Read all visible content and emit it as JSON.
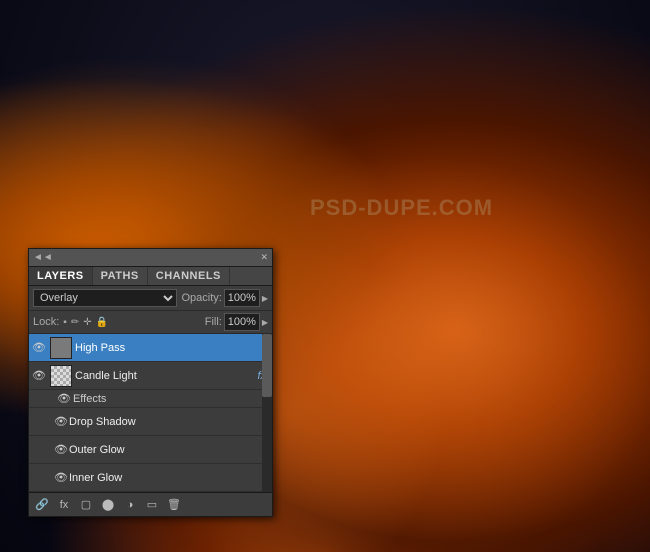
{
  "bg": {
    "alt": "Halloween pumpkin with fire and dark forest background"
  },
  "panel": {
    "title_arrows": "◄◄",
    "close_btn": "✕",
    "tabs": [
      {
        "label": "LAYERS",
        "active": true
      },
      {
        "label": "PATHS",
        "active": false
      },
      {
        "label": "CHANNELS",
        "active": false
      }
    ],
    "blend_mode": {
      "label": "",
      "value": "Overlay",
      "opacity_label": "Opacity:",
      "opacity_value": "100%"
    },
    "lock_row": {
      "label": "Lock:",
      "fill_label": "Fill:",
      "fill_value": "100%"
    },
    "layers": [
      {
        "id": "high-pass",
        "name": "High Pass",
        "visible": true,
        "selected": true,
        "thumb_type": "gray-solid",
        "has_fx": false
      },
      {
        "id": "candle-light",
        "name": "Candle Light",
        "visible": true,
        "selected": false,
        "thumb_type": "checked",
        "has_fx": true
      }
    ],
    "effects_group": {
      "label": "Effects",
      "items": [
        {
          "name": "Drop Shadow"
        },
        {
          "name": "Outer Glow"
        },
        {
          "name": "Inner Glow"
        }
      ]
    },
    "toolbar_buttons": [
      {
        "name": "link-icon",
        "symbol": "🔗"
      },
      {
        "name": "fx-icon",
        "symbol": "fx"
      },
      {
        "name": "new-layer-icon",
        "symbol": "▢"
      },
      {
        "name": "mask-icon",
        "symbol": "⬤"
      },
      {
        "name": "adjustment-icon",
        "symbol": "◑"
      },
      {
        "name": "group-icon",
        "symbol": "▭"
      },
      {
        "name": "delete-icon",
        "symbol": "🗑"
      }
    ]
  },
  "watermark": {
    "text": "PSD-DUPE.COM"
  }
}
